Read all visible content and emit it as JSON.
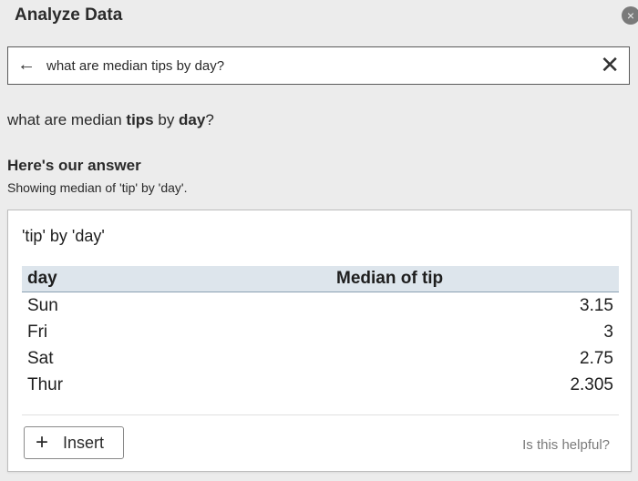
{
  "pane": {
    "title": "Analyze Data",
    "close_icon": "×"
  },
  "search": {
    "back_icon": "←",
    "query": "what are median tips by day?",
    "clear_icon": "✕"
  },
  "question": {
    "p1": "what are median ",
    "b1": "tips",
    "p2": " by ",
    "b2": "day",
    "p3": "?"
  },
  "answer": {
    "heading": "Here's our answer",
    "subtitle": "Showing median of 'tip' by 'day'."
  },
  "card": {
    "title": "'tip' by 'day'",
    "table": {
      "headers": [
        "day",
        "Median of tip"
      ],
      "rows": [
        [
          "Sun",
          "3.15"
        ],
        [
          "Fri",
          "3"
        ],
        [
          "Sat",
          "2.75"
        ],
        [
          "Thur",
          "2.305"
        ]
      ]
    },
    "insert_icon": "+",
    "insert_label": "Insert",
    "helpful_text": "Is this helpful?"
  },
  "colors": {
    "background": "#ececec",
    "header_fill": "#dde5ec"
  }
}
